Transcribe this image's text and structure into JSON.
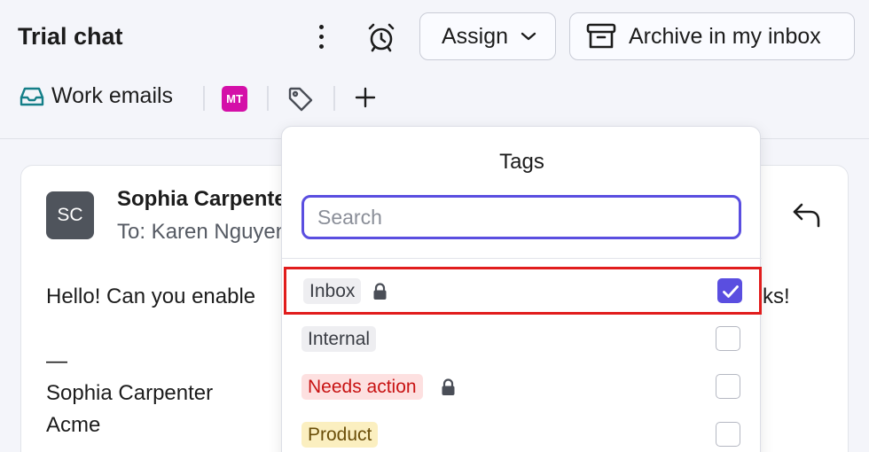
{
  "header": {
    "title": "Trial chat",
    "assign_label": "Assign",
    "archive_label": "Archive in my inbox"
  },
  "subbar": {
    "inbox_label": "Work emails",
    "assignee_initials": "MT"
  },
  "message": {
    "sender_initials": "SC",
    "sender_name": "Sophia Carpenter",
    "to_line": "To: Karen Nguyen",
    "body_start": "Hello! Can you enable",
    "body_end": "ks!",
    "sig_dash": "—",
    "sig_name": "Sophia Carpenter",
    "sig_company": "Acme"
  },
  "tags_popup": {
    "title": "Tags",
    "search_placeholder": "Search",
    "items": [
      {
        "label": "Inbox",
        "locked": true,
        "checked": true,
        "color": "gray"
      },
      {
        "label": "Internal",
        "locked": false,
        "checked": false,
        "color": "gray"
      },
      {
        "label": "Needs action",
        "locked": true,
        "checked": false,
        "color": "red"
      },
      {
        "label": "Product",
        "locked": false,
        "checked": false,
        "color": "yellow"
      }
    ]
  },
  "colors": {
    "accent": "#5a4ee0",
    "highlight": "#e11d1d",
    "assignee_badge": "#d40fa8"
  }
}
